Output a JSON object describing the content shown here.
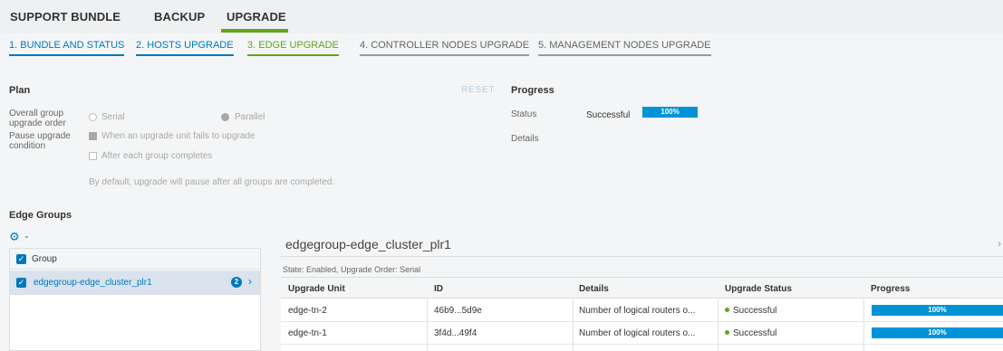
{
  "topnav": {
    "tabs": [
      "SUPPORT BUNDLE",
      "BACKUP",
      "UPGRADE"
    ],
    "active": "UPGRADE"
  },
  "steps": [
    "1. BUNDLE AND STATUS",
    "2. HOSTS UPGRADE",
    "3. EDGE UPGRADE",
    "4. CONTROLLER NODES UPGRADE",
    "5. MANAGEMENT NODES UPGRADE"
  ],
  "plan": {
    "title": "Plan",
    "reset_label": "RESET",
    "order_label_1": "Overall group",
    "order_label_2": "upgrade order",
    "serial_label": "Serial",
    "parallel_label": "Parallel",
    "pause_label_1": "Pause upgrade",
    "pause_label_2": "condition",
    "fail_label": "When an upgrade unit fails to upgrade",
    "after_group_label": "After each group completes",
    "note": "By default, upgrade will pause after all groups are completed."
  },
  "progress": {
    "title": "Progress",
    "status_label": "Status",
    "status_value": "Successful",
    "percent": "100%",
    "details_label": "Details"
  },
  "edge_groups": {
    "title": "Edge Groups",
    "group_col": "Group",
    "items": [
      {
        "name": "edgegroup-edge_cluster_plr1",
        "count": "2"
      }
    ]
  },
  "detail": {
    "title": "edgegroup-edge_cluster_plr1",
    "subtitle": "State: Enabled, Upgrade Order: Serial",
    "columns": [
      "Upgrade Unit",
      "ID",
      "Details",
      "Upgrade Status",
      "Progress"
    ],
    "rows": [
      {
        "unit": "edge-tn-2",
        "id": "46b9...5d9e",
        "details": "Number of logical routers o...",
        "status": "Successful",
        "progress": "100%"
      },
      {
        "unit": "edge-tn-1",
        "id": "3f4d...49f4",
        "details": "Number of logical routers o...",
        "status": "Successful",
        "progress": "100%"
      }
    ]
  },
  "colors": {
    "accent_blue": "#0079b8",
    "progress_blue": "#0094d6",
    "success_green": "#62a420"
  }
}
